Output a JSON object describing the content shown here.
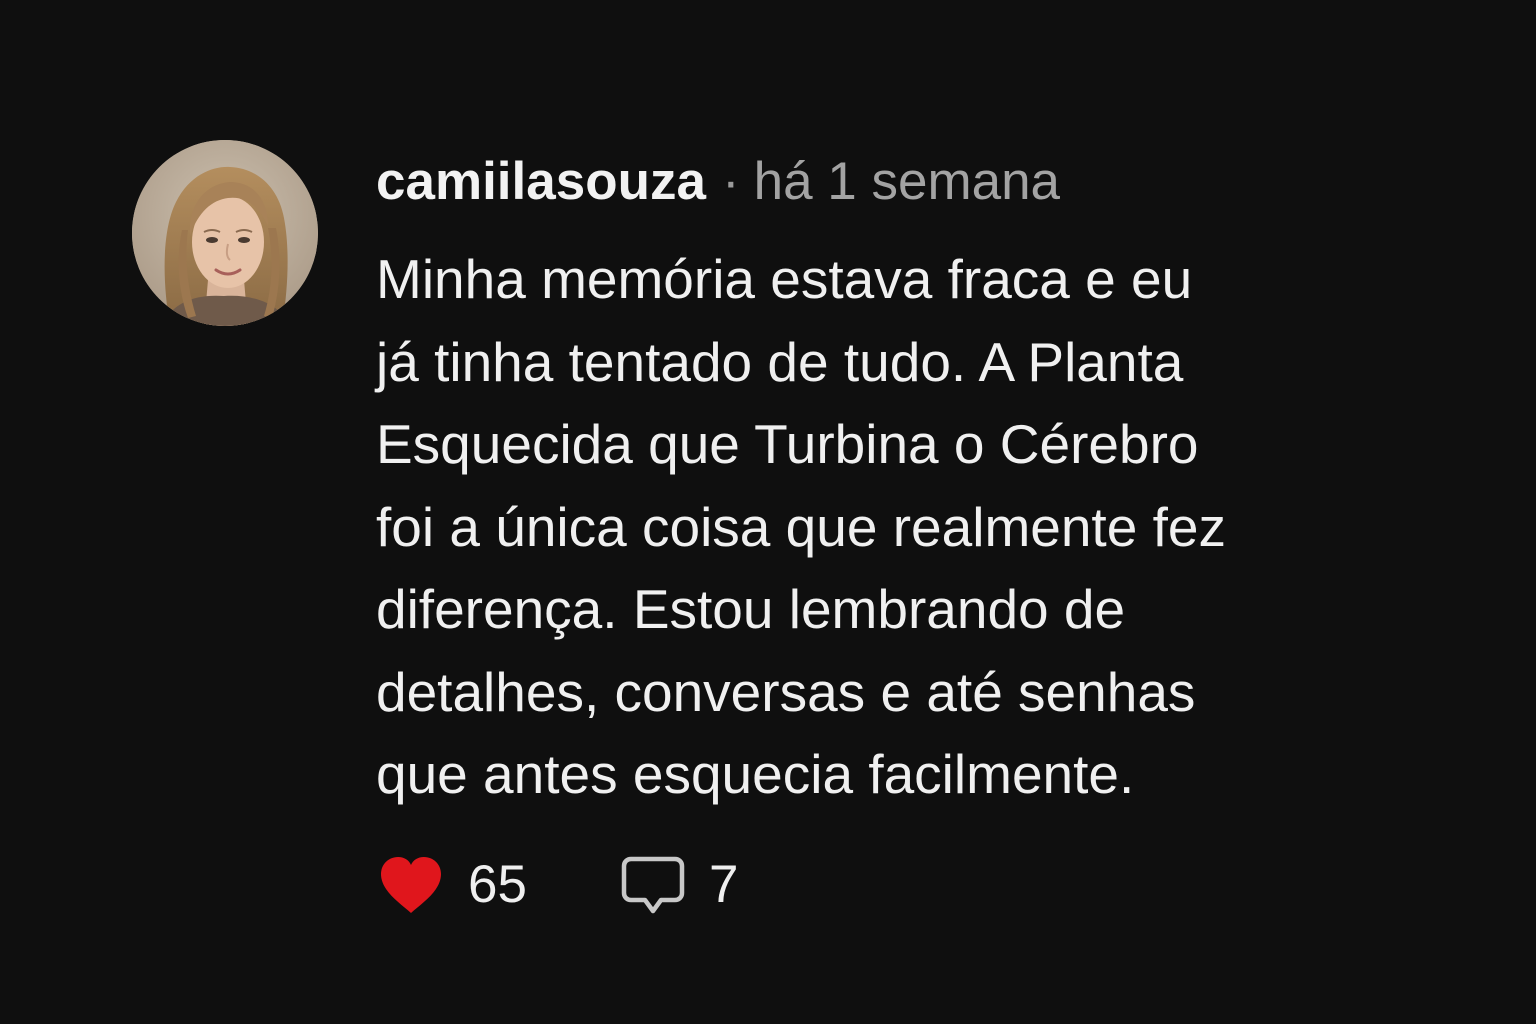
{
  "comment": {
    "username": "camiilasouza",
    "separator": "·",
    "timestamp": "há 1 semana",
    "text": "Minha memória estava fraca e eu\njá tinha tentado de tudo. A Planta\nEsquecida que Turbina o Cérebro\nfoi a única coisa que realmente fez\ndiferença. Estou lembrando de\ndetalhes, conversas e até senhas\nque antes esquecia facilmente.",
    "likes": "65",
    "replies": "7"
  },
  "icons": {
    "like": "heart-icon",
    "reply": "speech-bubble-icon",
    "avatar": "user-photo"
  },
  "colors": {
    "background": "#0f0f0f",
    "heart": "#e0161c",
    "muted_text": "#a3a3a3"
  }
}
